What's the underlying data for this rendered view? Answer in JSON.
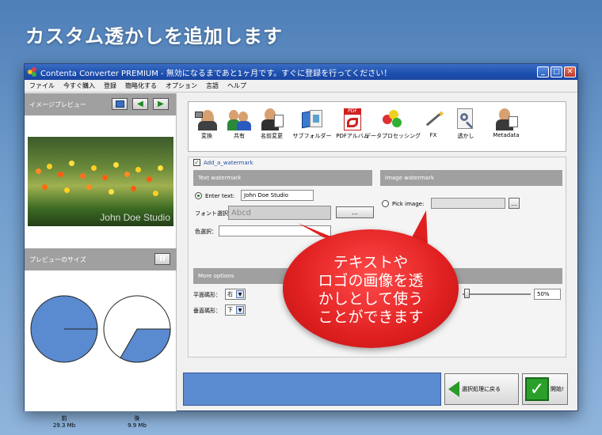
{
  "headline": "カスタム透かしを追加します",
  "window": {
    "title": "Contenta Converter PREMIUM - 無効になるまであと1ヶ月です。すぐに登録を行ってください！",
    "min_btn": "_",
    "max_btn": "□",
    "close_btn": "✕"
  },
  "menu": [
    "ファイル",
    "今すぐ購入",
    "登録",
    "簡略化する",
    "オプション",
    "言語",
    "ヘルプ"
  ],
  "left": {
    "preview_title": "イメージプレビュー",
    "watermark_overlay": "John Doe Studio",
    "size_title": "プレビューのサイズ",
    "pause_btn": "II",
    "before_label": "前",
    "before_size": "29.3 Mb",
    "after_label": "後",
    "after_size": "9.9 Mb"
  },
  "toolbar": [
    {
      "label": "変換",
      "icon": "convert-icon"
    },
    {
      "label": "共有",
      "icon": "share-icon"
    },
    {
      "label": "名前変更",
      "icon": "rename-icon"
    },
    {
      "label": "サブフォルダー",
      "icon": "subfolder-icon"
    },
    {
      "label": "PDFアルバム",
      "icon": "pdf-album-icon"
    },
    {
      "label": "データプロセッシング",
      "icon": "data-processing-icon"
    },
    {
      "label": "FX",
      "icon": "fx-icon"
    },
    {
      "label": "透かし",
      "icon": "watermark-icon"
    },
    {
      "label": "Metadata",
      "icon": "metadata-icon"
    }
  ],
  "settings": {
    "checkbox_label": "Add_a_watermark",
    "text_watermark_title": "Text watermark",
    "image_watermark_title": "Image watermark",
    "enter_text_label": "Enter text:",
    "enter_text_value": "John Doe Studio",
    "font_label": "フォント選択：",
    "font_value": "Abcd",
    "font_btn": "...",
    "color_label": "色選択：",
    "pick_image_label": "Pick image:",
    "pick_btn": "...",
    "more_options_title": "More options",
    "horizontal_label": "平面碼形：",
    "horizontal_value": "右",
    "vertical_label": "垂直碼形：",
    "vertical_value": "下",
    "opacity_value": "50%"
  },
  "buttons": {
    "back_label": "選択処理に戻る",
    "start_label": "開始!"
  },
  "callout": "テキストや\nロゴの画像を透\nかしとして使う\nことができます",
  "colors": {
    "accent_blue": "#5a8ad0",
    "callout_red": "#e02020",
    "header_gray": "#a0a0a0"
  }
}
